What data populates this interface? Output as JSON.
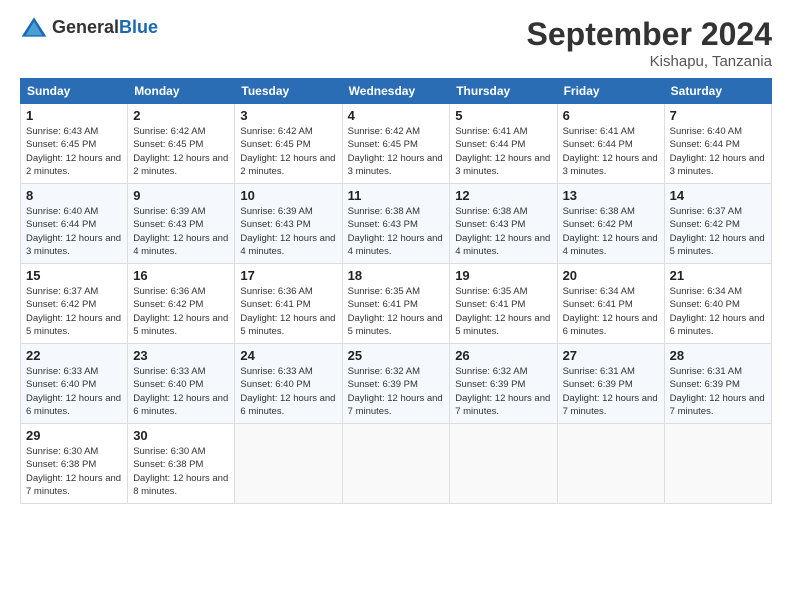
{
  "header": {
    "logo_general": "General",
    "logo_blue": "Blue",
    "month_title": "September 2024",
    "location": "Kishapu, Tanzania"
  },
  "weekdays": [
    "Sunday",
    "Monday",
    "Tuesday",
    "Wednesday",
    "Thursday",
    "Friday",
    "Saturday"
  ],
  "days": [
    {
      "date": "",
      "sunrise": "",
      "sunset": "",
      "daylight": ""
    },
    {
      "date": "1",
      "sunrise": "Sunrise: 6:43 AM",
      "sunset": "Sunset: 6:45 PM",
      "daylight": "Daylight: 12 hours and 2 minutes."
    },
    {
      "date": "2",
      "sunrise": "Sunrise: 6:42 AM",
      "sunset": "Sunset: 6:45 PM",
      "daylight": "Daylight: 12 hours and 2 minutes."
    },
    {
      "date": "3",
      "sunrise": "Sunrise: 6:42 AM",
      "sunset": "Sunset: 6:45 PM",
      "daylight": "Daylight: 12 hours and 2 minutes."
    },
    {
      "date": "4",
      "sunrise": "Sunrise: 6:42 AM",
      "sunset": "Sunset: 6:45 PM",
      "daylight": "Daylight: 12 hours and 3 minutes."
    },
    {
      "date": "5",
      "sunrise": "Sunrise: 6:41 AM",
      "sunset": "Sunset: 6:44 PM",
      "daylight": "Daylight: 12 hours and 3 minutes."
    },
    {
      "date": "6",
      "sunrise": "Sunrise: 6:41 AM",
      "sunset": "Sunset: 6:44 PM",
      "daylight": "Daylight: 12 hours and 3 minutes."
    },
    {
      "date": "7",
      "sunrise": "Sunrise: 6:40 AM",
      "sunset": "Sunset: 6:44 PM",
      "daylight": "Daylight: 12 hours and 3 minutes."
    },
    {
      "date": "8",
      "sunrise": "Sunrise: 6:40 AM",
      "sunset": "Sunset: 6:44 PM",
      "daylight": "Daylight: 12 hours and 3 minutes."
    },
    {
      "date": "9",
      "sunrise": "Sunrise: 6:39 AM",
      "sunset": "Sunset: 6:43 PM",
      "daylight": "Daylight: 12 hours and 4 minutes."
    },
    {
      "date": "10",
      "sunrise": "Sunrise: 6:39 AM",
      "sunset": "Sunset: 6:43 PM",
      "daylight": "Daylight: 12 hours and 4 minutes."
    },
    {
      "date": "11",
      "sunrise": "Sunrise: 6:38 AM",
      "sunset": "Sunset: 6:43 PM",
      "daylight": "Daylight: 12 hours and 4 minutes."
    },
    {
      "date": "12",
      "sunrise": "Sunrise: 6:38 AM",
      "sunset": "Sunset: 6:43 PM",
      "daylight": "Daylight: 12 hours and 4 minutes."
    },
    {
      "date": "13",
      "sunrise": "Sunrise: 6:38 AM",
      "sunset": "Sunset: 6:42 PM",
      "daylight": "Daylight: 12 hours and 4 minutes."
    },
    {
      "date": "14",
      "sunrise": "Sunrise: 6:37 AM",
      "sunset": "Sunset: 6:42 PM",
      "daylight": "Daylight: 12 hours and 5 minutes."
    },
    {
      "date": "15",
      "sunrise": "Sunrise: 6:37 AM",
      "sunset": "Sunset: 6:42 PM",
      "daylight": "Daylight: 12 hours and 5 minutes."
    },
    {
      "date": "16",
      "sunrise": "Sunrise: 6:36 AM",
      "sunset": "Sunset: 6:42 PM",
      "daylight": "Daylight: 12 hours and 5 minutes."
    },
    {
      "date": "17",
      "sunrise": "Sunrise: 6:36 AM",
      "sunset": "Sunset: 6:41 PM",
      "daylight": "Daylight: 12 hours and 5 minutes."
    },
    {
      "date": "18",
      "sunrise": "Sunrise: 6:35 AM",
      "sunset": "Sunset: 6:41 PM",
      "daylight": "Daylight: 12 hours and 5 minutes."
    },
    {
      "date": "19",
      "sunrise": "Sunrise: 6:35 AM",
      "sunset": "Sunset: 6:41 PM",
      "daylight": "Daylight: 12 hours and 5 minutes."
    },
    {
      "date": "20",
      "sunrise": "Sunrise: 6:34 AM",
      "sunset": "Sunset: 6:41 PM",
      "daylight": "Daylight: 12 hours and 6 minutes."
    },
    {
      "date": "21",
      "sunrise": "Sunrise: 6:34 AM",
      "sunset": "Sunset: 6:40 PM",
      "daylight": "Daylight: 12 hours and 6 minutes."
    },
    {
      "date": "22",
      "sunrise": "Sunrise: 6:33 AM",
      "sunset": "Sunset: 6:40 PM",
      "daylight": "Daylight: 12 hours and 6 minutes."
    },
    {
      "date": "23",
      "sunrise": "Sunrise: 6:33 AM",
      "sunset": "Sunset: 6:40 PM",
      "daylight": "Daylight: 12 hours and 6 minutes."
    },
    {
      "date": "24",
      "sunrise": "Sunrise: 6:33 AM",
      "sunset": "Sunset: 6:40 PM",
      "daylight": "Daylight: 12 hours and 6 minutes."
    },
    {
      "date": "25",
      "sunrise": "Sunrise: 6:32 AM",
      "sunset": "Sunset: 6:39 PM",
      "daylight": "Daylight: 12 hours and 7 minutes."
    },
    {
      "date": "26",
      "sunrise": "Sunrise: 6:32 AM",
      "sunset": "Sunset: 6:39 PM",
      "daylight": "Daylight: 12 hours and 7 minutes."
    },
    {
      "date": "27",
      "sunrise": "Sunrise: 6:31 AM",
      "sunset": "Sunset: 6:39 PM",
      "daylight": "Daylight: 12 hours and 7 minutes."
    },
    {
      "date": "28",
      "sunrise": "Sunrise: 6:31 AM",
      "sunset": "Sunset: 6:39 PM",
      "daylight": "Daylight: 12 hours and 7 minutes."
    },
    {
      "date": "29",
      "sunrise": "Sunrise: 6:30 AM",
      "sunset": "Sunset: 6:38 PM",
      "daylight": "Daylight: 12 hours and 7 minutes."
    },
    {
      "date": "30",
      "sunrise": "Sunrise: 6:30 AM",
      "sunset": "Sunset: 6:38 PM",
      "daylight": "Daylight: 12 hours and 8 minutes."
    }
  ]
}
